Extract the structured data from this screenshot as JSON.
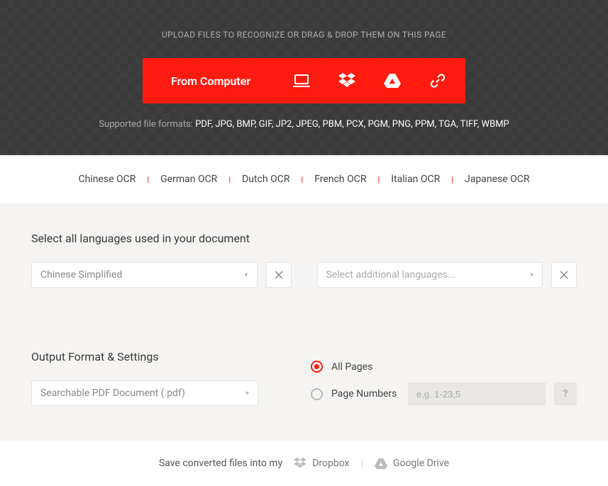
{
  "header": {
    "instruction": "UPLOAD FILES TO RECOGNIZE OR DRAG & DROP THEM ON THIS PAGE",
    "from_computer_label": "From Computer",
    "formats_prefix": "Supported file formats: ",
    "formats_list": "PDF, JPG, BMP, GIF, JP2, JPEG, PBM, PCX, PGM, PNG, PPM, TGA, TIFF, WBMP"
  },
  "ocr_links": [
    "Chinese OCR",
    "German OCR",
    "Dutch OCR",
    "French OCR",
    "Italian OCR",
    "Japanese OCR"
  ],
  "languages": {
    "section_title": "Select all languages used in your document",
    "primary_selected": "Chinese Simplified",
    "additional_placeholder": "Select additional languages..."
  },
  "output": {
    "section_title": "Output Format & Settings",
    "format_selected": "Searchable PDF Document (.pdf)",
    "pages": {
      "all_label": "All Pages",
      "numbers_label": "Page Numbers",
      "numbers_placeholder": "e.g. 1-23,5",
      "selected": "all",
      "help_label": "?"
    }
  },
  "save_bar": {
    "prefix": "Save converted files into my",
    "dropbox_label": "Dropbox",
    "gdrive_label": "Google Drive"
  },
  "colors": {
    "accent": "#ff1b0f",
    "dark": "#3a3a3a",
    "grey_bg": "#f5f4f2"
  },
  "separator": "|"
}
